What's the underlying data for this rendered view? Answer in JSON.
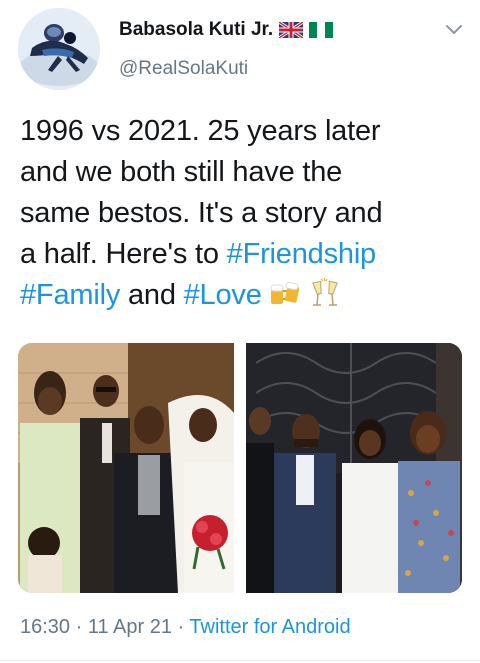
{
  "user": {
    "name": "Babasola Kuti Jr.",
    "handle": "@RealSolaKuti"
  },
  "tweet": {
    "lines": [
      [
        {
          "t": "1996 vs 2021. 25 years later"
        }
      ],
      [
        {
          "t": "and we both still have the"
        }
      ],
      [
        {
          "t": "same bestos. It's a story and"
        }
      ],
      [
        {
          "t": "a half. Here's to "
        },
        {
          "t": "#Friendship",
          "tag": true
        }
      ],
      [
        {
          "t": "#Family",
          "tag": true
        },
        {
          "t": " and "
        },
        {
          "t": "#Love",
          "tag": true
        }
      ]
    ],
    "emojis": [
      "beer-mugs-icon",
      "champagne-glasses-icon"
    ]
  },
  "meta": {
    "time": "16:30",
    "sep1": " · ",
    "date": "11 Apr 21",
    "sep2": " · ",
    "source": "Twitter for Android"
  },
  "colors": {
    "link": "#1b95e0",
    "secondary": "#657786",
    "text": "#14171a"
  },
  "icons": [
    "avatar-skydiving",
    "uk-flag-icon",
    "nigeria-flag-icon",
    "chevron-down-icon"
  ]
}
